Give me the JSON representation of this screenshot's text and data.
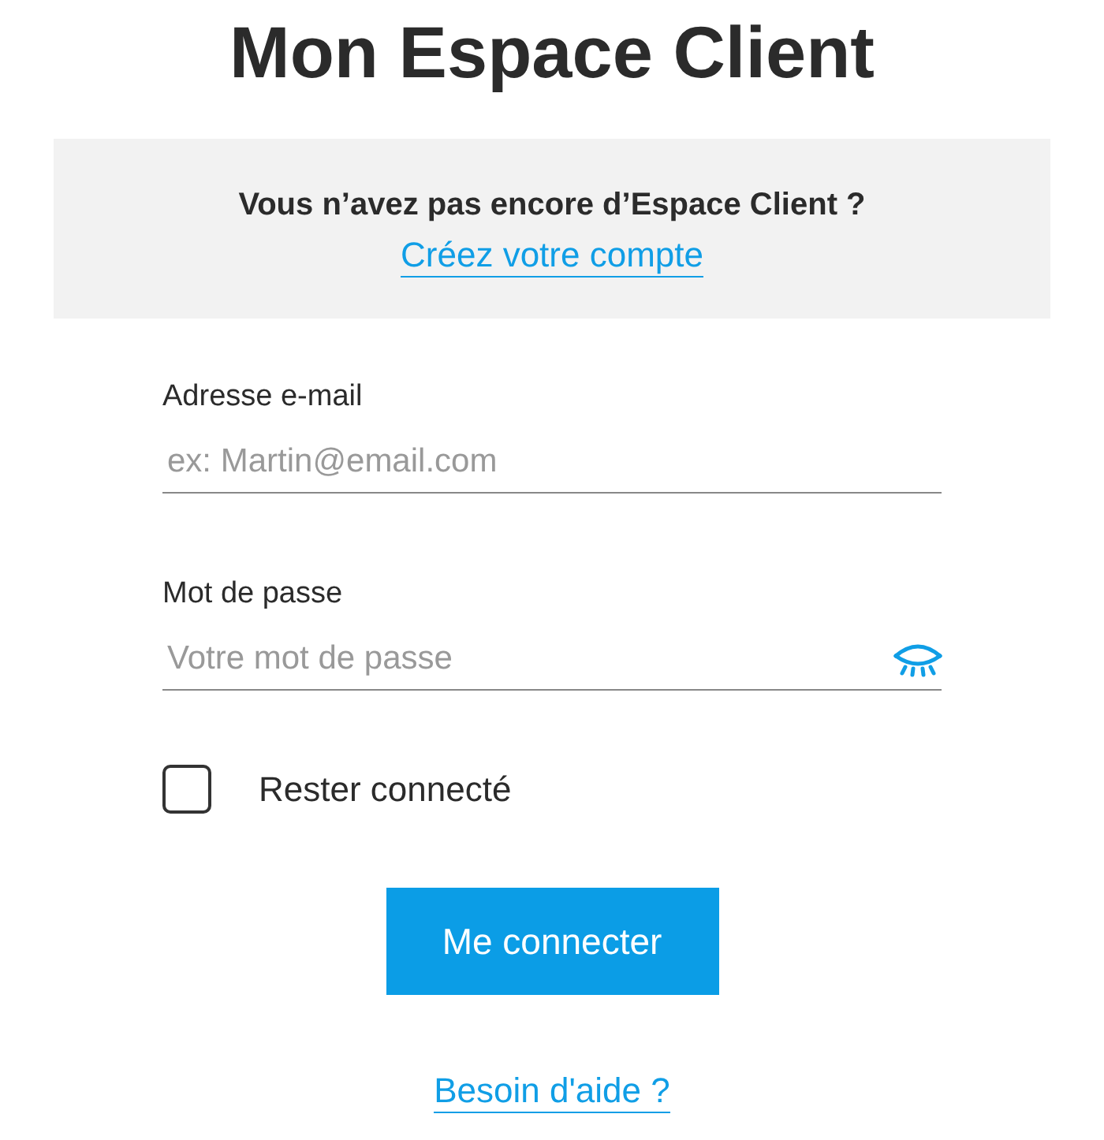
{
  "title": "Mon Espace Client",
  "signup": {
    "question": "Vous n’avez pas encore d’Espace Client ?",
    "link": "Créez votre compte"
  },
  "email": {
    "label": "Adresse e-mail",
    "placeholder": "ex: Martin@email.com"
  },
  "password": {
    "label": "Mot de passe",
    "placeholder": "Votre mot de passe"
  },
  "remember": {
    "label": "Rester connecté",
    "checked": false
  },
  "submit": "Me connecter",
  "help": "Besoin d'aide ?"
}
